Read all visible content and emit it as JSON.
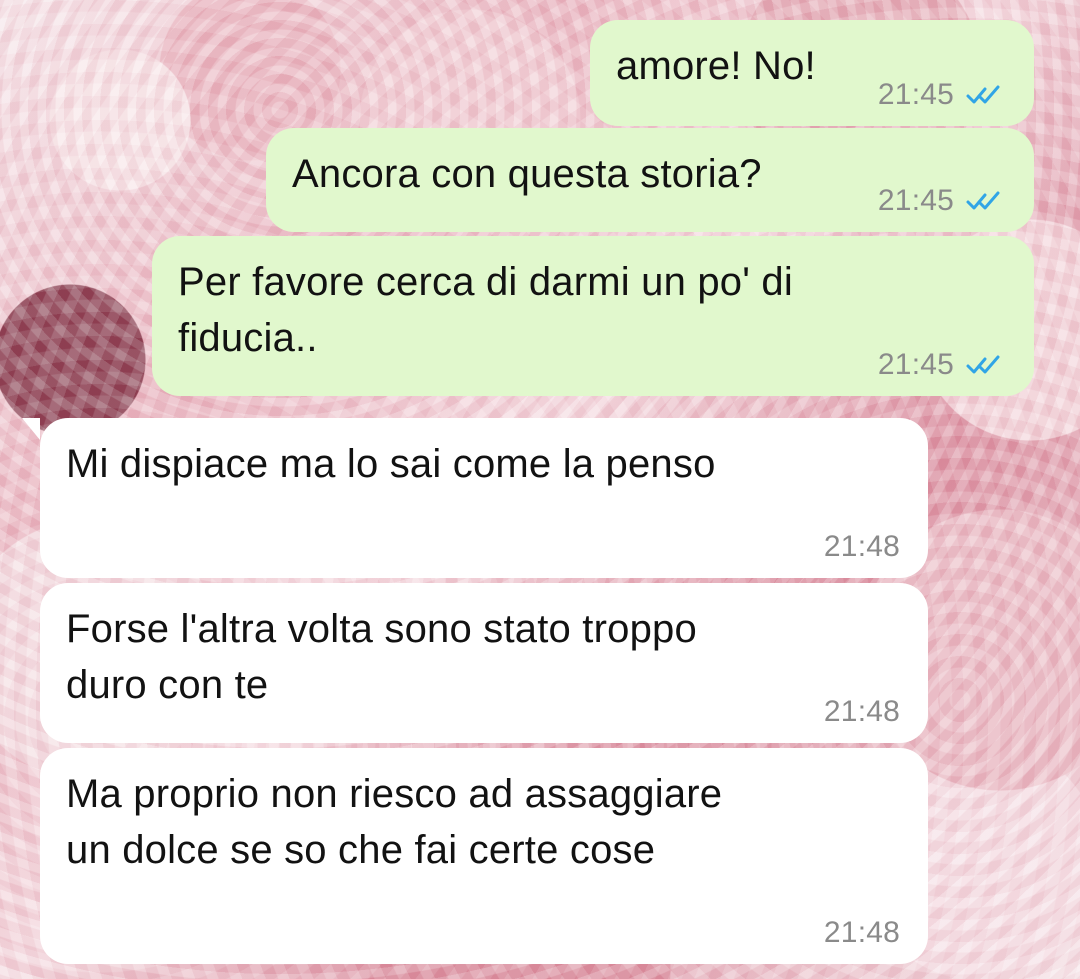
{
  "messages": [
    {
      "text": "amore! No!",
      "time": "21:45",
      "direction": "outgoing",
      "status_icon": "double-check-blue"
    },
    {
      "text": "Ancora con questa storia?",
      "time": "21:45",
      "direction": "outgoing",
      "status_icon": "double-check-blue"
    },
    {
      "text": "Per favore cerca di darmi un po' di\nfiducia..",
      "time": "21:45",
      "direction": "outgoing",
      "status_icon": "double-check-blue"
    },
    {
      "text": "Mi dispiace ma lo sai come la penso",
      "time": "21:48",
      "direction": "incoming"
    },
    {
      "text": "Forse l'altra volta sono stato troppo\nduro con te",
      "time": "21:48",
      "direction": "incoming"
    },
    {
      "text": "Ma proprio non riesco ad assaggiare\nun dolce se so che fai certe cose",
      "time": "21:48",
      "direction": "incoming"
    }
  ],
  "colors": {
    "outgoing_bubble": "#e1f8cd",
    "incoming_bubble": "#ffffff",
    "message_text": "#121212",
    "meta_text": "#8a8a8a",
    "read_check": "#31a5e6"
  }
}
